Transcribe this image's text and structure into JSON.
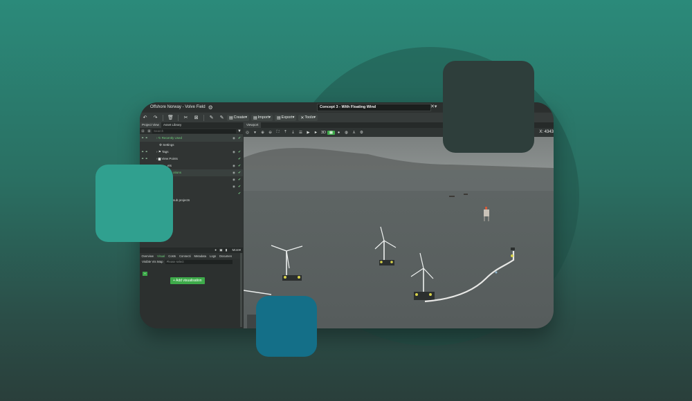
{
  "colors": {
    "bg_top": "#2b8a7a",
    "bg_bottom": "#2a3f3b",
    "accent_green": "#3eaa4a",
    "deco_dark": "#2e3e3b",
    "deco_teal": "#30a08f",
    "deco_blue": "#146f88"
  },
  "titlebar": {
    "app_title": "Offshore Norway - Volve Field",
    "settings_icon": "⚙",
    "concept": "Concept 3 - With Floating Wind",
    "tool_icon": "✕▾"
  },
  "toolbar": {
    "icons": [
      "↶",
      "↷",
      "🗑",
      "✂",
      "⊠",
      "✎",
      "✎"
    ],
    "create": "Create",
    "import": "Import",
    "export": "Export",
    "tools": "Tools"
  },
  "left": {
    "tabs": [
      "Project View",
      "Asset Library"
    ],
    "search_placeholder": "Search",
    "tree": [
      {
        "label": "Recently Used",
        "green": true
      },
      {
        "label": "Settings"
      },
      {
        "label": "Tags"
      },
      {
        "label": "View Points"
      },
      {
        "label": "ets"
      },
      {
        "label": "otions",
        "green": true
      },
      {
        "label": ""
      },
      {
        "label": ""
      },
      {
        "label": ""
      },
      {
        "label": "sub projects"
      }
    ],
    "sub": {
      "header_tool": "More",
      "tabs": [
        "Overview",
        "Visual",
        "Costs",
        "Connecti",
        "Metadata",
        "Logs",
        "Documen"
      ],
      "vis_label": "Visible Vis Map",
      "select_placeholder": "Please select",
      "add_button": "+ Add visualisation"
    }
  },
  "viewport": {
    "tab": "Viewport",
    "coord": "X: 4343",
    "toolbar_3d": "3D"
  }
}
